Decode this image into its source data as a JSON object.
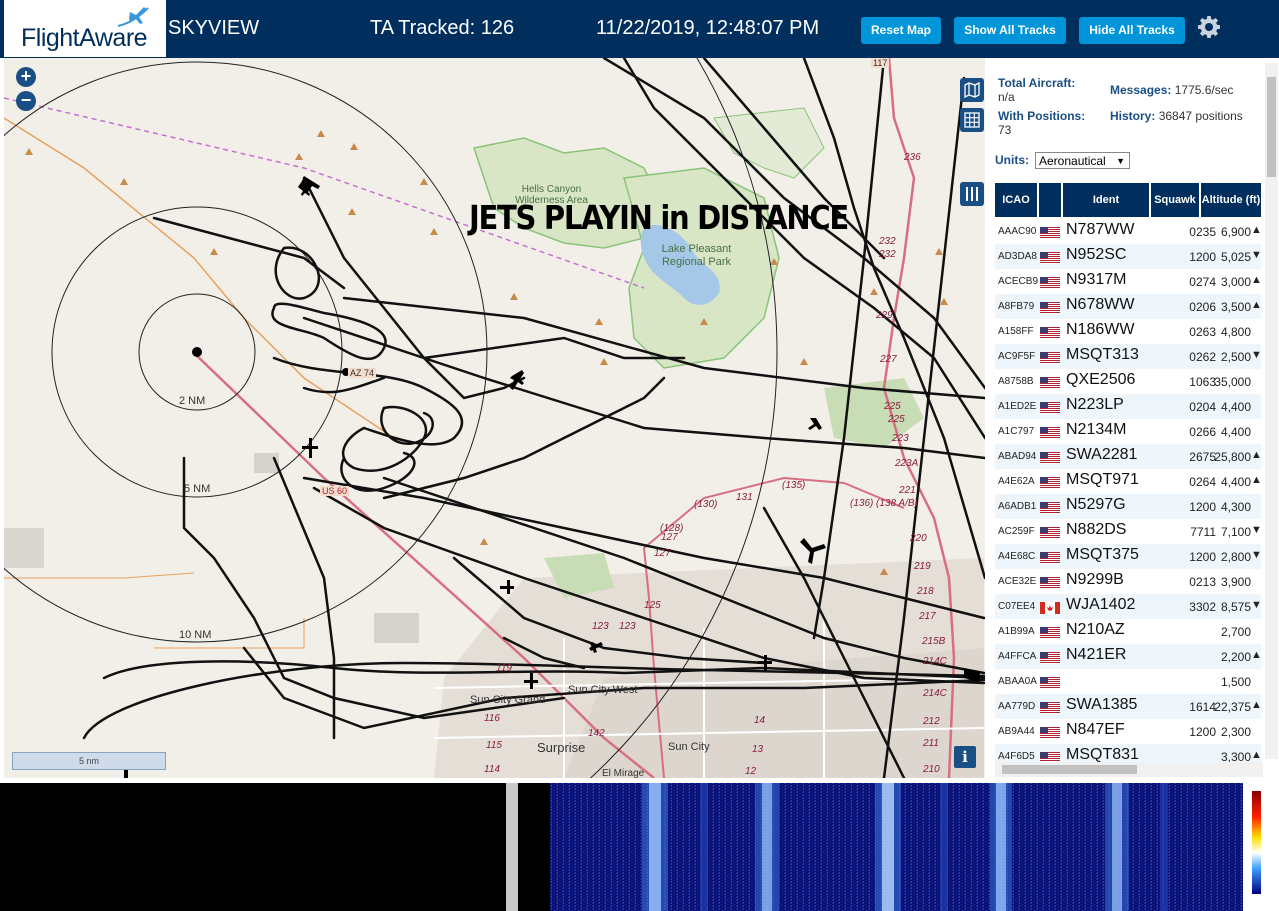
{
  "header": {
    "logo_text": "FlightAware",
    "app_name": "SKYVIEW",
    "tracked": "TA Tracked: 126",
    "datetime": "11/22/2019, 12:48:07 PM",
    "buttons": [
      "Reset Map",
      "Show All Tracks",
      "Hide All Tracks"
    ],
    "settings_icon": "gear-icon"
  },
  "map": {
    "overlay_text": "JETS PLAYIN in DISTANCE",
    "range_labels": [
      "2 NM",
      "5 NM",
      "10 NM"
    ],
    "scale_label": "5 nm",
    "info_label": "i",
    "place_labels": [
      "Hells Canyon Wilderness Area",
      "Lake Pleasant Regional Park",
      "Sun City West",
      "Sun City Grand",
      "Surprise",
      "Sun City",
      "El Mirage"
    ],
    "road_labels": [
      "AZ 74",
      "US 60",
      "117"
    ],
    "route_numbers": [
      "236",
      "232",
      "232",
      "229",
      "227",
      "225",
      "225",
      "223",
      "223A",
      "221",
      "220",
      "219",
      "218",
      "217",
      "215B",
      "214C",
      "214C",
      "212",
      "211",
      "210",
      "(135)",
      "(136)",
      "(138 A/B)",
      "131",
      "(130)",
      "(128)",
      "127",
      "127",
      "125",
      "123",
      "123",
      "119",
      "116",
      "115",
      "114",
      "14",
      "13",
      "12",
      "142"
    ]
  },
  "stats": {
    "total_aircraft_label": "Total Aircraft:",
    "total_aircraft_value": "n/a",
    "with_positions_label": "With Positions:",
    "with_positions_value": "73",
    "messages_label": "Messages:",
    "messages_value": "1775.6/sec",
    "history_label": "History:",
    "history_value": "36847 positions",
    "units_label": "Units:",
    "units_value": "Aeronautical"
  },
  "table": {
    "columns": [
      "ICAO",
      "",
      "Ident",
      "Squawk",
      "Altitude (ft)"
    ],
    "rows": [
      {
        "icao": "AAAC90",
        "flag": "us",
        "ident": "N787WW",
        "squawk": "0235",
        "alt": "6,900",
        "trend": "▲"
      },
      {
        "icao": "AD3DA8",
        "flag": "us",
        "ident": "N952SC",
        "squawk": "1200",
        "alt": "5,025",
        "trend": "▼"
      },
      {
        "icao": "ACECB9",
        "flag": "us",
        "ident": "N9317M",
        "squawk": "0274",
        "alt": "3,000",
        "trend": "▲"
      },
      {
        "icao": "A8FB79",
        "flag": "us",
        "ident": "N678WW",
        "squawk": "0206",
        "alt": "3,500",
        "trend": "▲"
      },
      {
        "icao": "A158FF",
        "flag": "us",
        "ident": "N186WW",
        "squawk": "0263",
        "alt": "4,800",
        "trend": ""
      },
      {
        "icao": "AC9F5F",
        "flag": "us",
        "ident": "MSQT313",
        "squawk": "0262",
        "alt": "2,500",
        "trend": "▼"
      },
      {
        "icao": "A8758B",
        "flag": "us",
        "ident": "QXE2506",
        "squawk": "1063",
        "alt": "35,000",
        "trend": ""
      },
      {
        "icao": "A1ED2E",
        "flag": "us",
        "ident": "N223LP",
        "squawk": "0204",
        "alt": "4,400",
        "trend": ""
      },
      {
        "icao": "A1C797",
        "flag": "us",
        "ident": "N2134M",
        "squawk": "0266",
        "alt": "4,400",
        "trend": ""
      },
      {
        "icao": "ABAD94",
        "flag": "us",
        "ident": "SWA2281",
        "squawk": "2675",
        "alt": "25,800",
        "trend": "▲"
      },
      {
        "icao": "A4E62A",
        "flag": "us",
        "ident": "MSQT971",
        "squawk": "0264",
        "alt": "4,400",
        "trend": "▲"
      },
      {
        "icao": "A6ADB1",
        "flag": "us",
        "ident": "N5297G",
        "squawk": "1200",
        "alt": "4,300",
        "trend": ""
      },
      {
        "icao": "AC259F",
        "flag": "us",
        "ident": "N882DS",
        "squawk": "7711",
        "alt": "7,100",
        "trend": "▼"
      },
      {
        "icao": "A4E68C",
        "flag": "us",
        "ident": "MSQT375",
        "squawk": "1200",
        "alt": "2,800",
        "trend": "▼"
      },
      {
        "icao": "ACE32E",
        "flag": "us",
        "ident": "N9299B",
        "squawk": "0213",
        "alt": "3,900",
        "trend": ""
      },
      {
        "icao": "C07EE4",
        "flag": "ca",
        "ident": "WJA1402",
        "squawk": "3302",
        "alt": "8,575",
        "trend": "▼"
      },
      {
        "icao": "A1B99A",
        "flag": "us",
        "ident": "N210AZ",
        "squawk": "",
        "alt": "2,700",
        "trend": ""
      },
      {
        "icao": "A4FFCA",
        "flag": "us",
        "ident": "N421ER",
        "squawk": "",
        "alt": "2,200",
        "trend": "▲"
      },
      {
        "icao": "ABAA0A",
        "flag": "us",
        "ident": "",
        "squawk": "",
        "alt": "1,500",
        "trend": ""
      },
      {
        "icao": "AA779D",
        "flag": "us",
        "ident": "SWA1385",
        "squawk": "1614",
        "alt": "22,375",
        "trend": "▲"
      },
      {
        "icao": "AB9A44",
        "flag": "us",
        "ident": "N847EF",
        "squawk": "1200",
        "alt": "2,300",
        "trend": ""
      },
      {
        "icao": "A4F6D5",
        "flag": "us",
        "ident": "MSQT831",
        "squawk": "",
        "alt": "3,300",
        "trend": "▲"
      }
    ]
  },
  "colors": {
    "header_bg": "#002f5d",
    "button_bg": "#0094d8",
    "label_blue": "#1a4f86",
    "map_bg": "#f2efe9",
    "water": "#a5c8e8",
    "park": "#8bc27a",
    "route": "#d66a84"
  }
}
